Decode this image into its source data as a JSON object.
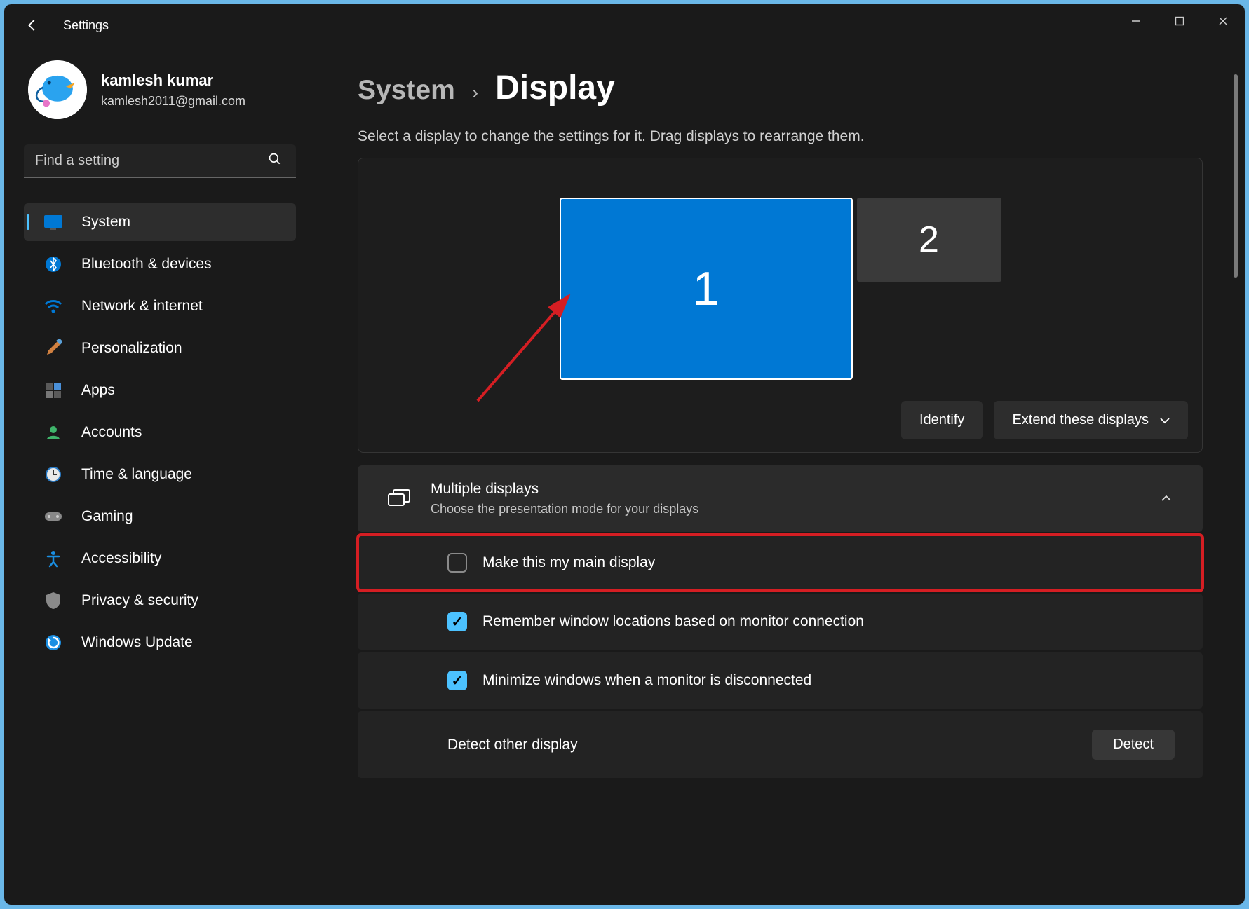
{
  "window": {
    "title": "Settings"
  },
  "profile": {
    "name": "kamlesh kumar",
    "email": "kamlesh2011@gmail.com"
  },
  "search": {
    "placeholder": "Find a setting"
  },
  "sidebar": {
    "items": [
      {
        "label": "System",
        "icon": "🖥️",
        "selected": true
      },
      {
        "label": "Bluetooth & devices",
        "icon": "bt",
        "selected": false
      },
      {
        "label": "Network & internet",
        "icon": "wifi",
        "selected": false
      },
      {
        "label": "Personalization",
        "icon": "🖌️",
        "selected": false
      },
      {
        "label": "Apps",
        "icon": "apps",
        "selected": false
      },
      {
        "label": "Accounts",
        "icon": "👤",
        "selected": false
      },
      {
        "label": "Time & language",
        "icon": "🕒",
        "selected": false
      },
      {
        "label": "Gaming",
        "icon": "🎮",
        "selected": false
      },
      {
        "label": "Accessibility",
        "icon": "♿",
        "selected": false
      },
      {
        "label": "Privacy & security",
        "icon": "🛡️",
        "selected": false
      },
      {
        "label": "Windows Update",
        "icon": "🔄",
        "selected": false
      }
    ]
  },
  "breadcrumb": {
    "parent": "System",
    "current": "Display"
  },
  "hint": "Select a display to change the settings for it. Drag displays to rearrange them.",
  "displays": {
    "d1": "1",
    "d2": "2"
  },
  "actions": {
    "identify": "Identify",
    "extend": "Extend these displays"
  },
  "multiple": {
    "title": "Multiple displays",
    "subtitle": "Choose the presentation mode for your displays"
  },
  "options": {
    "main": "Make this my main display",
    "remember": "Remember window locations based on monitor connection",
    "minimize": "Minimize windows when a monitor is disconnected",
    "detect_label": "Detect other display",
    "detect_btn": "Detect"
  }
}
